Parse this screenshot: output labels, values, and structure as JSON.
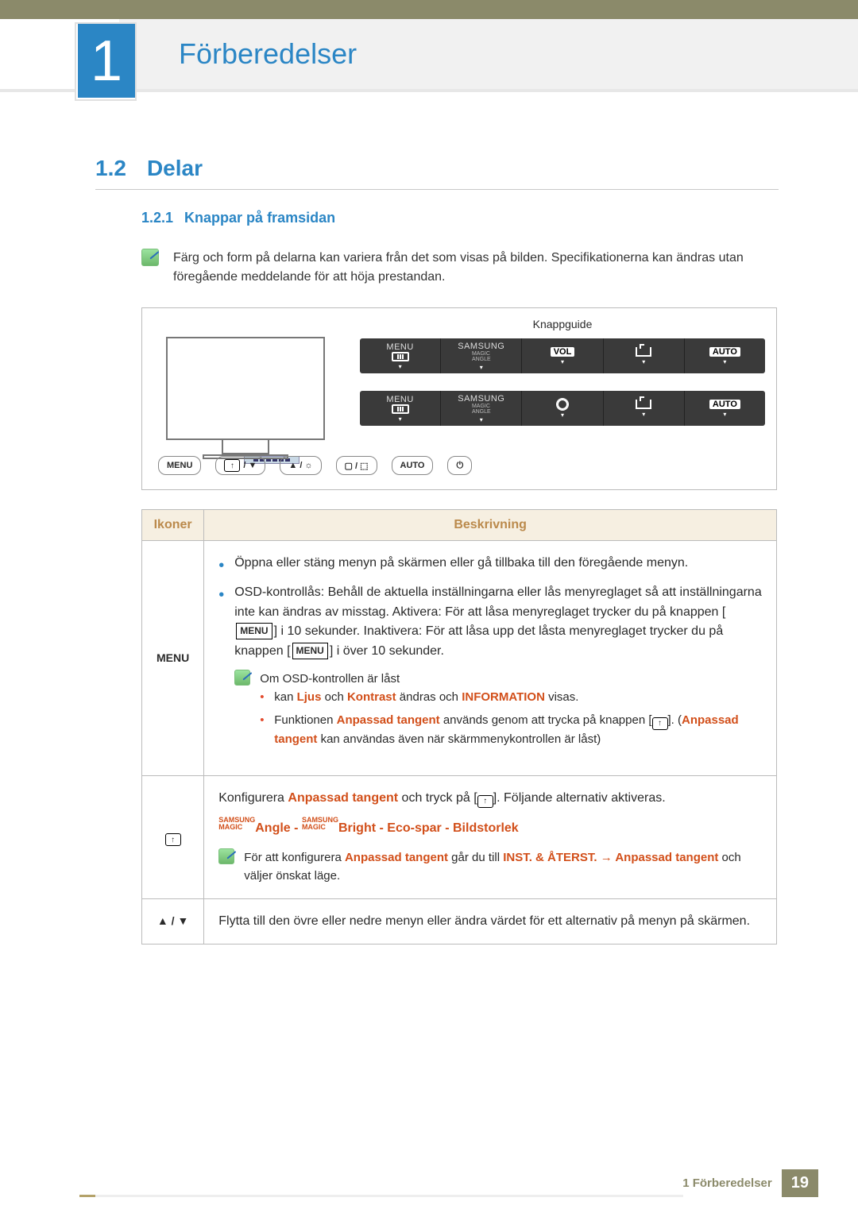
{
  "chapter": {
    "num": "1",
    "title": "Förberedelser"
  },
  "section": {
    "num": "1.2",
    "title": "Delar"
  },
  "subsection": {
    "num": "1.2.1",
    "title": "Knappar på framsidan"
  },
  "intro_note": "Färg och form på delarna kan variera från det som visas på bilden. Specifikationerna kan ändras utan föregående meddelande för att höja prestandan.",
  "diagram": {
    "guide_title": "Knappguide",
    "osd1": [
      "MENU",
      "SAMSUNG MAGIC ANGLE",
      "VOL",
      "",
      "AUTO"
    ],
    "osd2": [
      "MENU",
      "SAMSUNG MAGIC ANGLE",
      "",
      "",
      "AUTO"
    ],
    "btnrow": [
      "MENU",
      "⬚ / ▼",
      "▲ / ⊙",
      "▢ / ⬚",
      "AUTO",
      "⏻"
    ]
  },
  "table": {
    "headers": [
      "Ikoner",
      "Beskrivning"
    ],
    "rows": [
      {
        "icon": "MENU",
        "desc": {
          "b1": "Öppna eller stäng menyn på skärmen eller gå tillbaka till den föregående menyn.",
          "b2_pre": "OSD-kontrollås: Behåll de aktuella inställningarna eller lås menyreglaget så att inställningarna inte kan ändras av misstag. Aktivera: För att låsa menyreglaget trycker du på knappen [",
          "b2_mid": "] i 10 sekunder. Inaktivera: För att låsa upp det låsta menyreglaget trycker du på knappen [",
          "b2_post": "] i över 10 sekunder.",
          "sub_title": "Om OSD-kontrollen är låst",
          "sub1_pre": "kan ",
          "sub1_ljus": "Ljus",
          "sub1_mid1": " och ",
          "sub1_kontrast": "Kontrast",
          "sub1_mid2": " ändras och ",
          "sub1_info": "INFORMATION",
          "sub1_post": " visas.",
          "sub2_pre": "Funktionen ",
          "sub2_at": "Anpassad tangent",
          "sub2_mid1": " används genom att trycka på knappen [",
          "sub2_mid2": "]. (",
          "sub2_at2": "Anpassad tangent",
          "sub2_post": " kan användas även när skärmmenykontrollen är låst)"
        }
      },
      {
        "icon": "up-icon",
        "desc": {
          "p1_pre": "Konfigurera ",
          "p1_at": "Anpassad tangent",
          "p1_mid": " och tryck på [",
          "p1_post": "]. Följande alternativ aktiveras.",
          "opts_angle": "Angle",
          "opts_bright": "Bright",
          "opts_eco": "Eco-spar",
          "opts_bild": "Bildstorlek",
          "note_pre": "För att konfigurera ",
          "note_at": "Anpassad tangent",
          "note_mid": " går du till ",
          "note_inst": "INST. & ÅTERST.",
          "note_arrow": " → ",
          "note_at2": "Anpassad tangent",
          "note_post": " och väljer önskat läge."
        }
      },
      {
        "icon": "▲ / ▼",
        "desc_text": "Flytta till den övre eller nedre menyn eller ändra värdet för ett alternativ på menyn på skärmen."
      }
    ]
  },
  "footer": {
    "text": "1 Förberedelser",
    "page": "19"
  }
}
